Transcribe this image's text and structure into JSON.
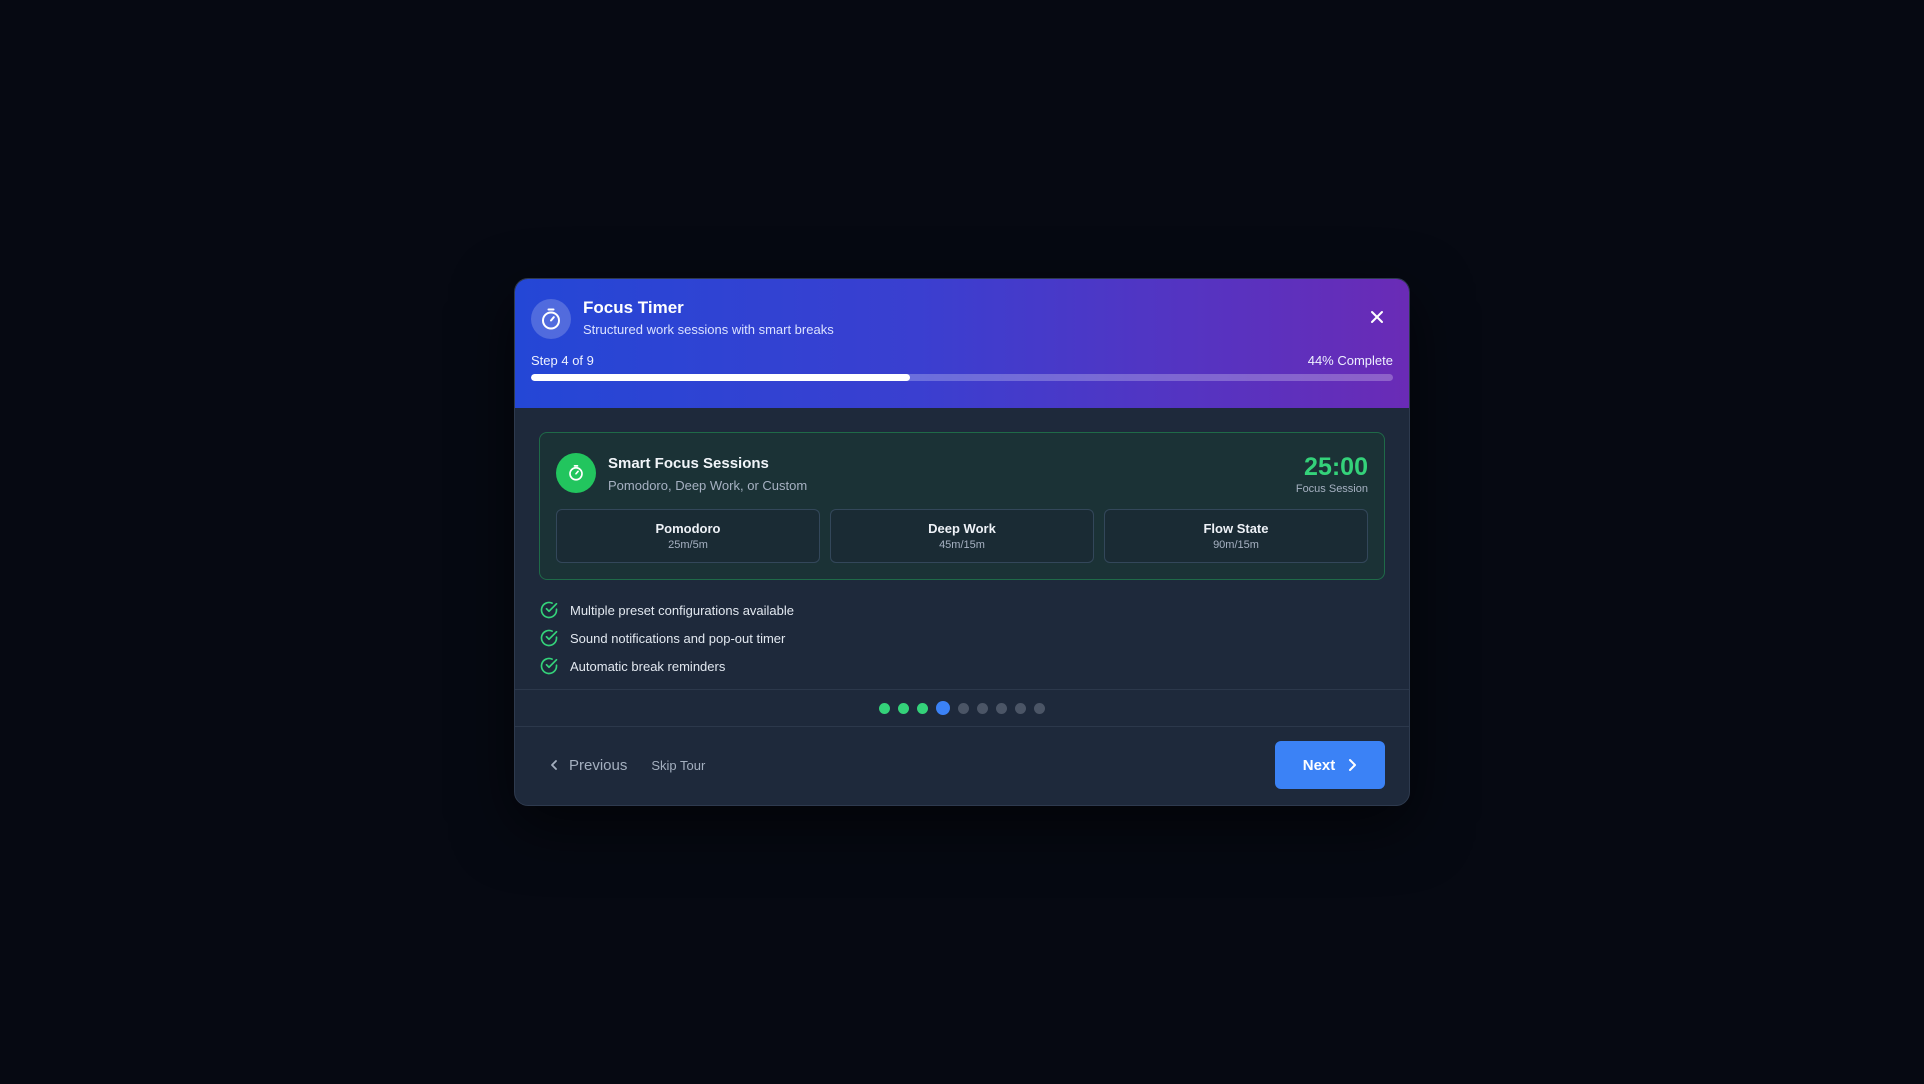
{
  "header": {
    "icon": "stopwatch-icon",
    "title": "Focus Timer",
    "subtitle": "Structured work sessions with smart breaks",
    "close_icon": "close-icon",
    "step_text": "Step 4 of 9",
    "complete_text": "44% Complete",
    "progress_fraction": 0.44
  },
  "feature_card": {
    "icon": "timer-icon",
    "title": "Smart Focus Sessions",
    "subtitle": "Pomodoro, Deep Work, or Custom",
    "timer_value": "25:00",
    "timer_label": "Focus Session",
    "presets": [
      {
        "name": "Pomodoro",
        "detail": "25m/5m"
      },
      {
        "name": "Deep Work",
        "detail": "45m/15m"
      },
      {
        "name": "Flow State",
        "detail": "90m/15m"
      }
    ]
  },
  "features": [
    "Multiple preset configurations available",
    "Sound notifications and pop-out timer",
    "Automatic break reminders"
  ],
  "steps": {
    "total": 9,
    "current": 4
  },
  "footer": {
    "previous_label": "Previous",
    "skip_label": "Skip Tour",
    "next_label": "Next"
  },
  "colors": {
    "accent_blue": "#3b82f6",
    "success_green": "#34d27a",
    "header_gradient_start": "#2447d6",
    "header_gradient_end": "#6a2bb6"
  }
}
